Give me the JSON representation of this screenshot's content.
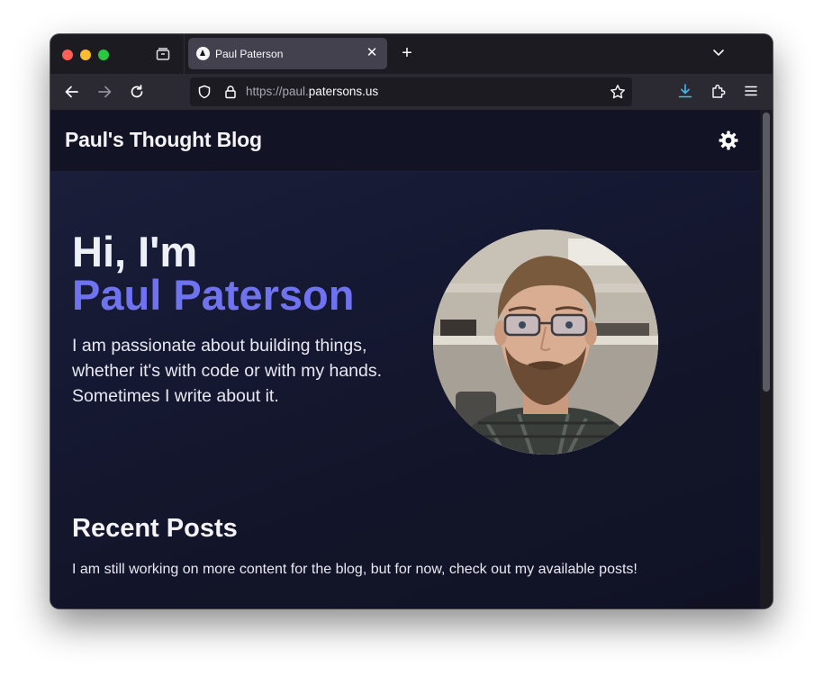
{
  "browser": {
    "tab": {
      "title": "Paul Paterson",
      "close_glyph": "✕"
    },
    "new_tab_glyph": "+",
    "url": {
      "prefix": "https://paul.",
      "domain": "patersons.us"
    },
    "icons": {
      "tab_overview": "tab-overview-icon",
      "favicon": "triangle-favicon-icon",
      "tab_list": "chevron-down-icon",
      "back": "arrow-left-icon",
      "forward": "arrow-right-icon",
      "reload": "reload-icon",
      "shield": "shield-icon",
      "lock": "lock-icon",
      "bookmark": "star-icon",
      "downloads": "download-icon",
      "extensions": "puzzle-icon",
      "menu": "hamburger-icon"
    },
    "colors": {
      "toolbar": "#2b2a33",
      "tab_active": "#42414d",
      "download_accent": "#3fbcec"
    }
  },
  "site": {
    "title": "Paul's Thought Blog",
    "theme_toggle_icon": "sun-icon",
    "hero": {
      "greeting": "Hi, I'm",
      "name": "Paul Paterson",
      "bio": "I am passionate about building things, whether it's with code or with my hands. Sometimes I write about it.",
      "avatar": "profile-photo"
    },
    "posts": {
      "heading": "Recent Posts",
      "intro": "I am still working on more content for the blog, but for now, check out my available posts!"
    },
    "colors": {
      "accent": "#6f73f0",
      "background": "#121527",
      "text": "#eef0f7"
    }
  }
}
